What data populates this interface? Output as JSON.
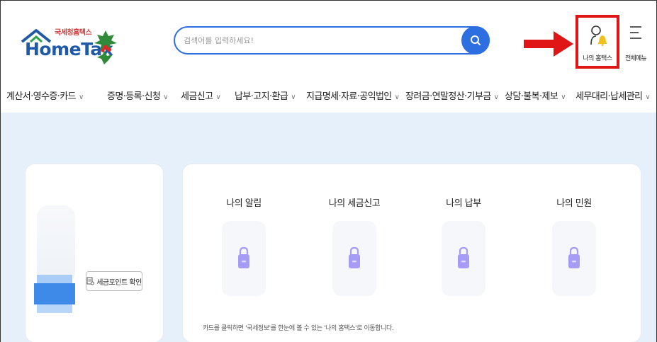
{
  "header": {
    "logo_small": "국세청홈택스",
    "logo_big": "HomeTax",
    "search_placeholder": "검색어를 입력하세요!",
    "my_hometax_label": "나의 홈택스",
    "all_menu_label": "전체메뉴"
  },
  "nav": {
    "items": [
      {
        "label": "계산서·영수증·카드"
      },
      {
        "label": "증명·등록·신청"
      },
      {
        "label": "세금신고"
      },
      {
        "label": "납부·고지·환급"
      },
      {
        "label": "지급명세·자료·공익법인"
      },
      {
        "label": "장려금·연말정산·기부금"
      },
      {
        "label": "상담·불복·제보"
      },
      {
        "label": "세무대리·납세관리"
      }
    ],
    "chevron": "∨"
  },
  "left_card": {
    "point_button_label": "세금포인트 확인"
  },
  "main_card": {
    "columns": [
      {
        "title": "나의 알림"
      },
      {
        "title": "나의 세금신고"
      },
      {
        "title": "나의 납부"
      },
      {
        "title": "나의 민원"
      }
    ],
    "notice": "카드를 클릭하면 '국세정보'를 한눈에 볼 수 있는 '나의 홈택스'로 이동합니다."
  },
  "colors": {
    "brand_blue": "#2d6fe0",
    "highlight_red": "#e01515",
    "lock_purple": "#a79cf5",
    "bell_yellow": "#f2c01e"
  },
  "icons": [
    "search-icon",
    "user-bell-icon",
    "hamburger-menu-icon",
    "arrow-right-icon",
    "lock-icon",
    "document-icon"
  ]
}
